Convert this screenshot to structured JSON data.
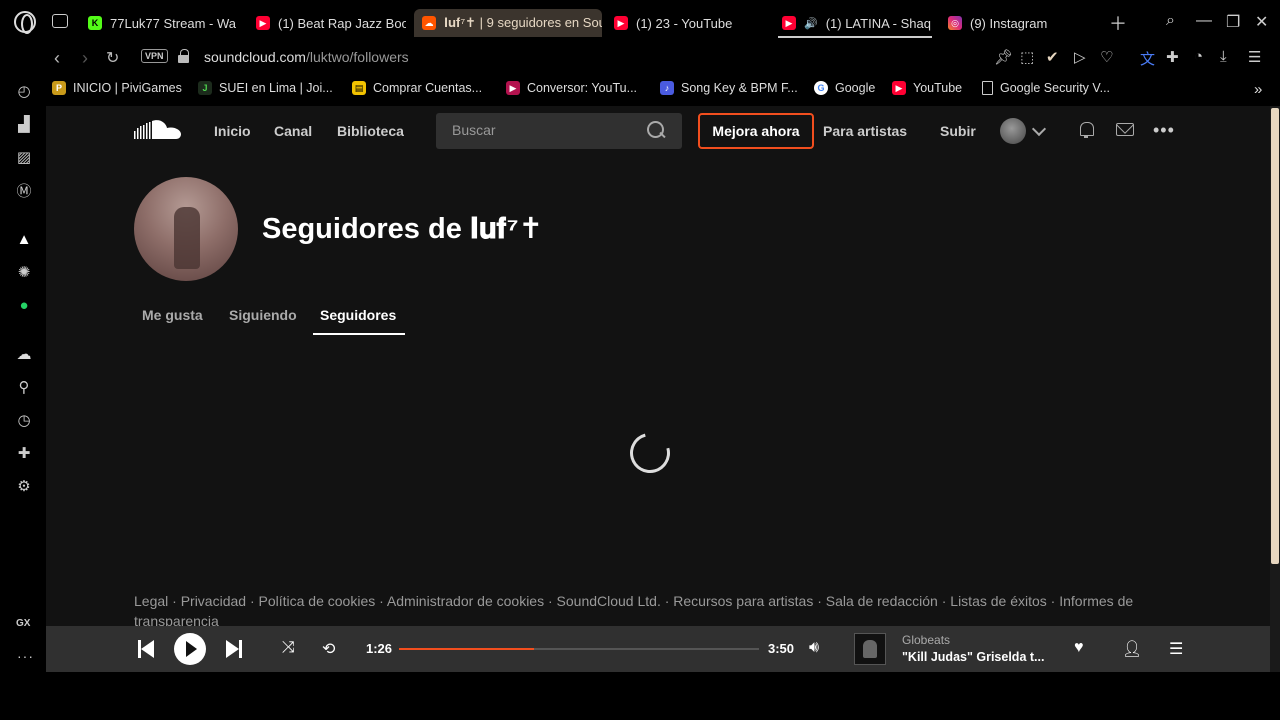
{
  "browser": {
    "tabs": [
      {
        "label": "77Luk77 Stream - Wa",
        "favicon": "kick-icon",
        "color": "#53fc18"
      },
      {
        "label": "(1) Beat Rap Jazz Boo",
        "favicon": "youtube-icon",
        "color": "#ff0033"
      },
      {
        "label": "𝐈𝐮𝐟⁷✝ | 9 seguidores en Sou",
        "favicon": "soundcloud-icon",
        "color": "#ff5500"
      },
      {
        "label": "(1) 23 - YouTube",
        "favicon": "youtube-icon",
        "color": "#ff0033"
      },
      {
        "label": "(1) LATINA - Shaq",
        "favicon": "youtube-icon",
        "color": "#ff0033"
      },
      {
        "label": "(9) Instagram",
        "favicon": "instagram-icon",
        "color": "#e1306c"
      }
    ],
    "vpn_label": "VPN",
    "url_domain": "soundcloud.com",
    "url_path": "/luktwo/followers",
    "bookmarks": [
      {
        "label": "INICIO | PiviGames",
        "icon": "pivigames-icon"
      },
      {
        "label": "SUEI en Lima | Joi...",
        "icon": "joinnus-icon"
      },
      {
        "label": "Comprar Cuentas...",
        "icon": "shop-icon"
      },
      {
        "label": "Conversor: YouTu...",
        "icon": "converter-icon"
      },
      {
        "label": "Song Key & BPM F...",
        "icon": "music-note-icon"
      },
      {
        "label": "Google",
        "icon": "google-icon"
      },
      {
        "label": "YouTube",
        "icon": "youtube-icon"
      },
      {
        "label": "Google Security V...",
        "icon": "page-icon"
      }
    ],
    "sidebar_gx": "GX"
  },
  "header": {
    "nav": [
      "Inicio",
      "Canal",
      "Biblioteca"
    ],
    "search_placeholder": "Buscar",
    "upgrade_label": "Mejora ahora",
    "for_artists": "Para artistas",
    "upload": "Subir"
  },
  "profile": {
    "title": "Seguidores de 𝐈𝐮𝐟⁷✝",
    "tabs": [
      "Me gusta",
      "Siguiendo",
      "Seguidores"
    ],
    "active_tab": "Seguidores"
  },
  "footer": {
    "links": "Legal · Privacidad · Política de cookies · Administrador de cookies · SoundCloud Ltd. · Recursos para artistas · Sala de redacción · Listas de éxitos · Informes de transparencia"
  },
  "player": {
    "elapsed": "1:26",
    "duration": "3:50",
    "progress_fraction": 0.374,
    "artist": "Globeats",
    "track": "\"Kill Judas\" Griselda t..."
  },
  "colors": {
    "accent": "#f24e1e",
    "page_bg": "#121212",
    "player_bg": "#303030"
  }
}
